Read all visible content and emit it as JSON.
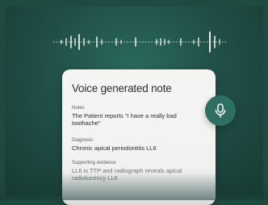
{
  "note": {
    "title": "Voice generated note",
    "sections": [
      {
        "label": "Notes",
        "text": "The Patient reports \"I have a really bad toothache\""
      },
      {
        "label": "Diagnosis",
        "text": "Chronic apical periodontitis LL6"
      },
      {
        "label": "Supporting evidence",
        "text": "LL6 is TTP and radiograph reveals apical radiolucency LL6"
      }
    ]
  },
  "colors": {
    "background": "#1f4a42",
    "accent": "#2f6e62",
    "card": "#f5f5f4"
  },
  "icons": {
    "mic": "microphone-icon",
    "waveform": "audio-waveform-icon"
  }
}
